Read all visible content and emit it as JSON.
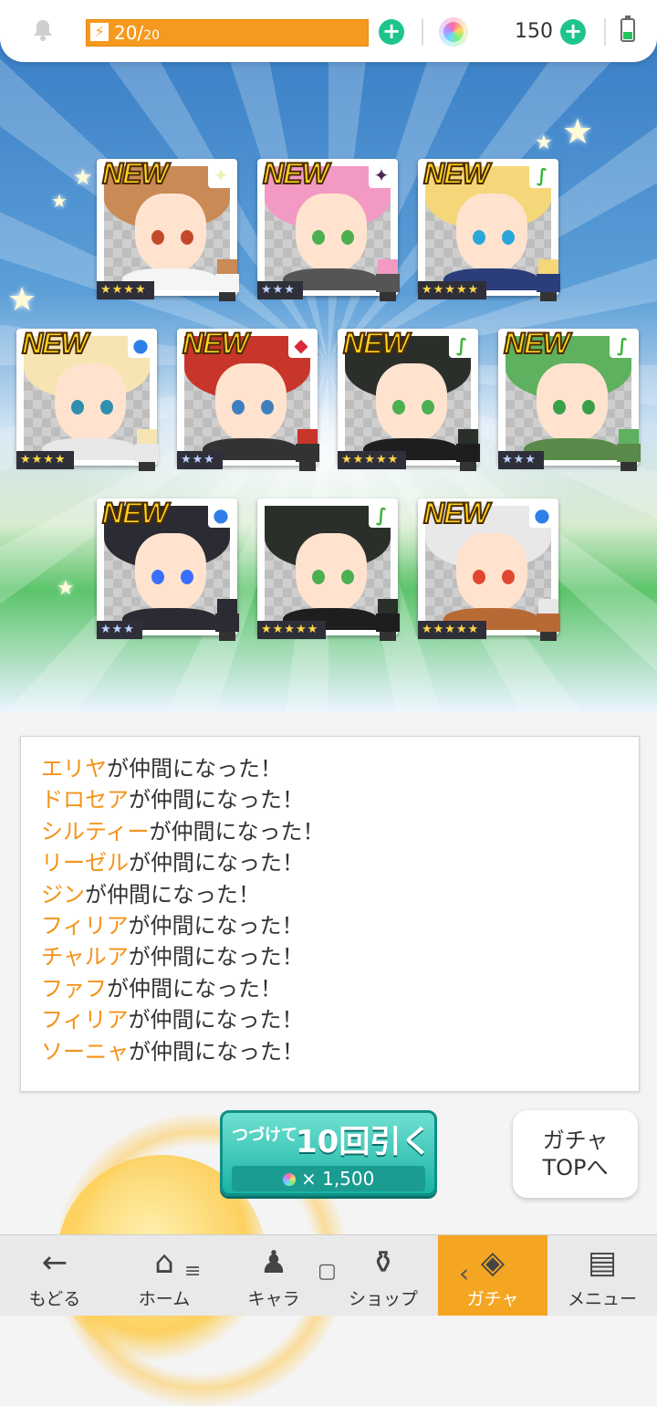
{
  "status_bar": {
    "stamina_value": "20/",
    "stamina_max": "20",
    "gem_count": "150"
  },
  "cards": [
    {
      "new": "NEW",
      "stars": "★★★★",
      "element": "✦",
      "element_color": "#e6f5b0",
      "hair": "#c98a55",
      "eye": "#c24a2a",
      "body": "#f5f5f5",
      "gold": true
    },
    {
      "new": "NEW",
      "stars": "★★★",
      "element": "✦",
      "element_color": "#4a2a55",
      "hair": "#f29ac4",
      "eye": "#4caf50",
      "body": "#555",
      "gold": false
    },
    {
      "new": "NEW",
      "stars": "★★★★★",
      "element": "∫",
      "element_color": "#3ab43a",
      "hair": "#f5d77a",
      "eye": "#2aa7d8",
      "body": "#2b3e7a",
      "gold": true
    },
    {
      "new": "NEW",
      "stars": "★★★★",
      "element": "●",
      "element_color": "#2f7fe8",
      "hair": "#f6e5b2",
      "eye": "#2e8fb0",
      "body": "#e8e8e8",
      "gold": true
    },
    {
      "new": "NEW",
      "stars": "★★★",
      "element": "◆",
      "element_color": "#d9283a",
      "hair": "#c8352a",
      "eye": "#3f7fbf",
      "body": "#333",
      "gold": false
    },
    {
      "new": "NEW",
      "stars": "★★★★★",
      "element": "∫",
      "element_color": "#3ab43a",
      "hair": "#2a2f2a",
      "eye": "#4caf50",
      "body": "#1e1e1e",
      "gold": true
    },
    {
      "new": "NEW",
      "stars": "★★★",
      "element": "∫",
      "element_color": "#3ab43a",
      "hair": "#5eb15e",
      "eye": "#3aa04a",
      "body": "#5a8a4a",
      "gold": false
    },
    {
      "new": "NEW",
      "stars": "★★★",
      "element": "●",
      "element_color": "#2f7fe8",
      "hair": "#2b2b33",
      "eye": "#3a6fff",
      "body": "#2b2b33",
      "gold": false
    },
    {
      "new": "",
      "stars": "★★★★★",
      "element": "∫",
      "element_color": "#3ab43a",
      "hair": "#2a2f2a",
      "eye": "#4caf50",
      "body": "#1e1e1e",
      "gold": true
    },
    {
      "new": "NEW",
      "stars": "★★★★★",
      "element": "●",
      "element_color": "#2f7fe8",
      "hair": "#e8e8e8",
      "eye": "#e0472f",
      "body": "#b86a35",
      "gold": true
    }
  ],
  "messages": [
    {
      "name": "エリヤ",
      "suffix": "が仲間になった！"
    },
    {
      "name": "ドロセア",
      "suffix": "が仲間になった！"
    },
    {
      "name": "シルティー",
      "suffix": "が仲間になった！"
    },
    {
      "name": "リーゼル",
      "suffix": "が仲間になった！"
    },
    {
      "name": "ジン",
      "suffix": "が仲間になった！"
    },
    {
      "name": "フィリア",
      "suffix": "が仲間になった！"
    },
    {
      "name": "チャルア",
      "suffix": "が仲間になった！"
    },
    {
      "name": "ファフ",
      "suffix": "が仲間になった！"
    },
    {
      "name": "フィリア",
      "suffix": "が仲間になった！"
    },
    {
      "name": "ソーニャ",
      "suffix": "が仲間になった！"
    }
  ],
  "draw_button": {
    "line1": "つづけて",
    "line2": "10回引く",
    "cost": "× 1,500"
  },
  "gacha_top_button": {
    "line1": "ガチャ",
    "line2": "TOPへ"
  },
  "nav": [
    {
      "label": "もどる",
      "icon": "back-arrow-icon",
      "glyph": "←",
      "active": false
    },
    {
      "label": "ホーム",
      "icon": "home-icon",
      "glyph": "⌂",
      "active": false
    },
    {
      "label": "キャラ",
      "icon": "character-icon",
      "glyph": "♟",
      "active": false
    },
    {
      "label": "ショップ",
      "icon": "shop-icon",
      "glyph": "⚱",
      "active": false
    },
    {
      "label": "ガチャ",
      "icon": "gacha-icon",
      "glyph": "◈",
      "active": true
    },
    {
      "label": "メニュー",
      "icon": "menu-icon",
      "glyph": "▤",
      "active": false
    }
  ],
  "system_buttons": {
    "recents": "≡",
    "home": "▢",
    "back": "‹"
  }
}
